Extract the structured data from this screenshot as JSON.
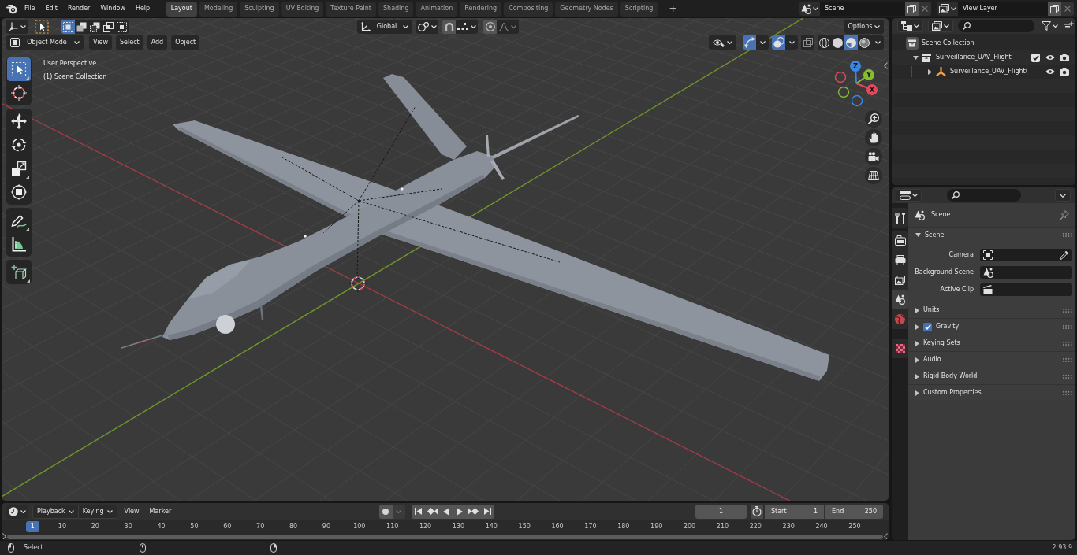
{
  "top_bar": {
    "menus": [
      "File",
      "Edit",
      "Render",
      "Window",
      "Help"
    ],
    "workspaces": [
      {
        "label": "Layout",
        "selected": true
      },
      {
        "label": "Modeling",
        "selected": false
      },
      {
        "label": "Sculpting",
        "selected": false
      },
      {
        "label": "UV Editing",
        "selected": false
      },
      {
        "label": "Texture Paint",
        "selected": false
      },
      {
        "label": "Shading",
        "selected": false
      },
      {
        "label": "Animation",
        "selected": false
      },
      {
        "label": "Rendering",
        "selected": false
      },
      {
        "label": "Compositing",
        "selected": false
      },
      {
        "label": "Geometry Nodes",
        "selected": false
      },
      {
        "label": "Scripting",
        "selected": false
      }
    ],
    "add_workspace": "+",
    "scene": {
      "value": "Scene"
    },
    "view_layer": {
      "value": "View Layer"
    }
  },
  "viewport": {
    "select_modes": [
      {
        "kind": "set",
        "selected": true
      },
      {
        "kind": "extend",
        "selected": false
      },
      {
        "kind": "subtract",
        "selected": false
      },
      {
        "kind": "invert",
        "selected": false
      },
      {
        "kind": "intersect",
        "selected": false
      }
    ],
    "orientation": "Global",
    "options": "Options",
    "mode": "Object Mode",
    "menus": [
      "View",
      "Select",
      "Add",
      "Object"
    ],
    "toggles": [
      {
        "kind": "gizmos",
        "on": true
      },
      {
        "kind": "overlays",
        "on": true
      },
      {
        "kind": "xray",
        "on": false
      }
    ],
    "shading": [
      {
        "kind": "wireframe",
        "selected": false
      },
      {
        "kind": "solid",
        "selected": false
      },
      {
        "kind": "material",
        "selected": true
      },
      {
        "kind": "rendered",
        "selected": false
      }
    ],
    "info": [
      "User Perspective",
      "(1) Scene Collection"
    ],
    "tool_groups": [
      [
        {
          "kind": "select_box",
          "selected": true
        },
        {
          "kind": "cursor",
          "selected": false
        }
      ],
      [
        {
          "kind": "move",
          "selected": false
        },
        {
          "kind": "rotate",
          "selected": false
        },
        {
          "kind": "scale",
          "selected": false
        },
        {
          "kind": "transform",
          "selected": false
        }
      ],
      [
        {
          "kind": "annotate",
          "selected": false
        },
        {
          "kind": "measure",
          "selected": false
        }
      ],
      [
        {
          "kind": "add_cube",
          "selected": false
        }
      ]
    ],
    "gizmo_axes": [
      {
        "label": "Z",
        "color": "#3a88e6"
      },
      {
        "label": "Y",
        "color": "#86bd2f"
      },
      {
        "label": "X",
        "color": "#e5485c"
      }
    ]
  },
  "timeline": {
    "menus": [
      {
        "label": "Playback",
        "kind": "dropdown"
      },
      {
        "label": "Keying",
        "kind": "dropdown"
      },
      {
        "label": "View",
        "kind": "menu"
      },
      {
        "label": "Marker",
        "kind": "menu"
      }
    ],
    "auto_keying": {
      "on": false
    },
    "current_frame": "1",
    "start": {
      "label": "Start",
      "value": "1"
    },
    "end": {
      "label": "End",
      "value": "250"
    },
    "ruler": [
      {
        "label": "1",
        "selected": true
      },
      {
        "label": "10",
        "selected": false
      },
      {
        "label": "20",
        "selected": false
      },
      {
        "label": "30",
        "selected": false
      },
      {
        "label": "40",
        "selected": false
      },
      {
        "label": "50",
        "selected": false
      },
      {
        "label": "60",
        "selected": false
      },
      {
        "label": "70",
        "selected": false
      },
      {
        "label": "80",
        "selected": false
      },
      {
        "label": "90",
        "selected": false
      },
      {
        "label": "100",
        "selected": false
      },
      {
        "label": "110",
        "selected": false
      },
      {
        "label": "120",
        "selected": false
      },
      {
        "label": "130",
        "selected": false
      },
      {
        "label": "140",
        "selected": false
      },
      {
        "label": "150",
        "selected": false
      },
      {
        "label": "160",
        "selected": false
      },
      {
        "label": "170",
        "selected": false
      },
      {
        "label": "180",
        "selected": false
      },
      {
        "label": "190",
        "selected": false
      },
      {
        "label": "200",
        "selected": false
      },
      {
        "label": "210",
        "selected": false
      },
      {
        "label": "220",
        "selected": false
      },
      {
        "label": "230",
        "selected": false
      },
      {
        "label": "240",
        "selected": false
      },
      {
        "label": "250",
        "selected": false
      }
    ]
  },
  "outliner": {
    "tree": [
      {
        "kind": "scene_collection",
        "label": "Scene Collection",
        "children": [
          {
            "kind": "collection",
            "label": "Surveillance_UAV_Flight",
            "expanded": true,
            "checked": true,
            "children": [
              {
                "kind": "empty",
                "label": "Surveillance_UAV_Flight(",
                "expanded": false
              }
            ]
          }
        ]
      }
    ]
  },
  "properties": {
    "tabs": [
      [
        {
          "kind": "tool",
          "selected": false
        }
      ],
      [
        {
          "kind": "render",
          "selected": false
        },
        {
          "kind": "output",
          "selected": false
        },
        {
          "kind": "view_layer",
          "selected": false
        },
        {
          "kind": "scene",
          "selected": true
        },
        {
          "kind": "world",
          "selected": false
        }
      ],
      [
        {
          "kind": "texture",
          "selected": false
        }
      ]
    ],
    "context": "Scene",
    "panel": {
      "title": "Scene",
      "expanded": true,
      "fields": [
        {
          "label": "Camera",
          "kind": "camera"
        },
        {
          "label": "Background Scene",
          "kind": "scene"
        },
        {
          "label": "Active Clip",
          "kind": "clip"
        }
      ]
    },
    "subpanels": [
      {
        "label": "Units",
        "kind": "plain",
        "expanded": false
      },
      {
        "label": "Gravity",
        "kind": "checkbox",
        "checked": true,
        "expanded": false
      },
      {
        "label": "Keying Sets",
        "kind": "plain",
        "expanded": false
      },
      {
        "label": "Audio",
        "kind": "plain",
        "expanded": false
      },
      {
        "label": "Rigid Body World",
        "kind": "plain",
        "expanded": false
      },
      {
        "label": "Custom Properties",
        "kind": "plain",
        "expanded": false
      }
    ]
  },
  "status_bar": {
    "hint": "Select",
    "version": "2.93.9"
  }
}
